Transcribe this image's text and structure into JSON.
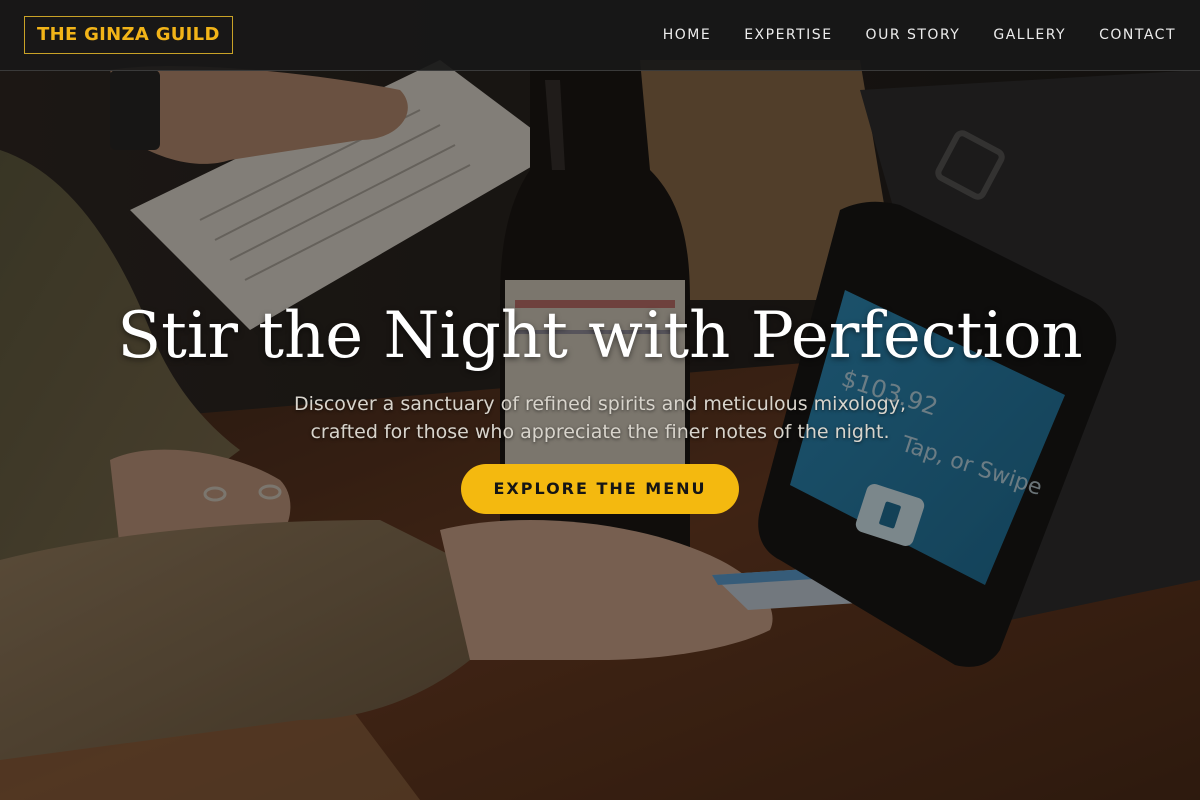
{
  "brand": {
    "logo_text": "THE GINZA GUILD",
    "accent_color": "#f4b90f"
  },
  "nav": {
    "items": [
      {
        "label": "HOME"
      },
      {
        "label": "EXPERTISE"
      },
      {
        "label": "OUR STORY"
      },
      {
        "label": "GALLERY"
      },
      {
        "label": "CONTACT"
      }
    ]
  },
  "hero": {
    "title": "Stir the Night with Perfection",
    "subtitle_line1": "Discover a sanctuary of refined spirits and meticulous mixology,",
    "subtitle_line2": "crafted for those who appreciate the finer notes of the night.",
    "cta_label": "EXPLORE THE MENU",
    "terminal_amount": "$103.92",
    "terminal_prompt": "Tap, or Swipe"
  }
}
